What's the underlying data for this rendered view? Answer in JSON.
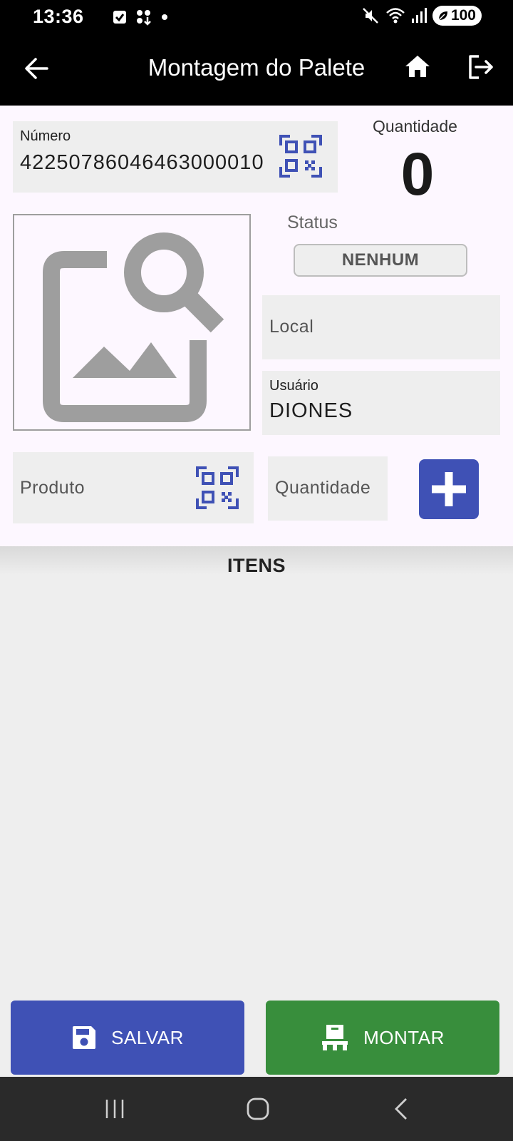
{
  "status_bar": {
    "time": "13:36",
    "battery": "100"
  },
  "app_bar": {
    "title": "Montagem do Palete",
    "icons": [
      "arrow-back-icon",
      "home-icon",
      "logout-icon"
    ]
  },
  "form": {
    "numero": {
      "label": "Número",
      "value": "42250786046463000010"
    },
    "quantidade": {
      "label": "Quantidade",
      "value": "0"
    },
    "status": {
      "label": "Status",
      "value": "NENHUM"
    },
    "local": {
      "placeholder": "Local"
    },
    "usuario": {
      "label": "Usuário",
      "value": "DIONES"
    },
    "produto": {
      "placeholder": "Produto"
    },
    "quantidade_input": {
      "placeholder": "Quantidade"
    }
  },
  "items": {
    "title": "ITENS",
    "rows": []
  },
  "actions": {
    "save_label": "SALVAR",
    "mount_label": "MONTAR"
  },
  "colors": {
    "primary": "#3f51b5",
    "success": "#388e3c",
    "background": "#fdf7ff",
    "field": "#eeeeee"
  }
}
